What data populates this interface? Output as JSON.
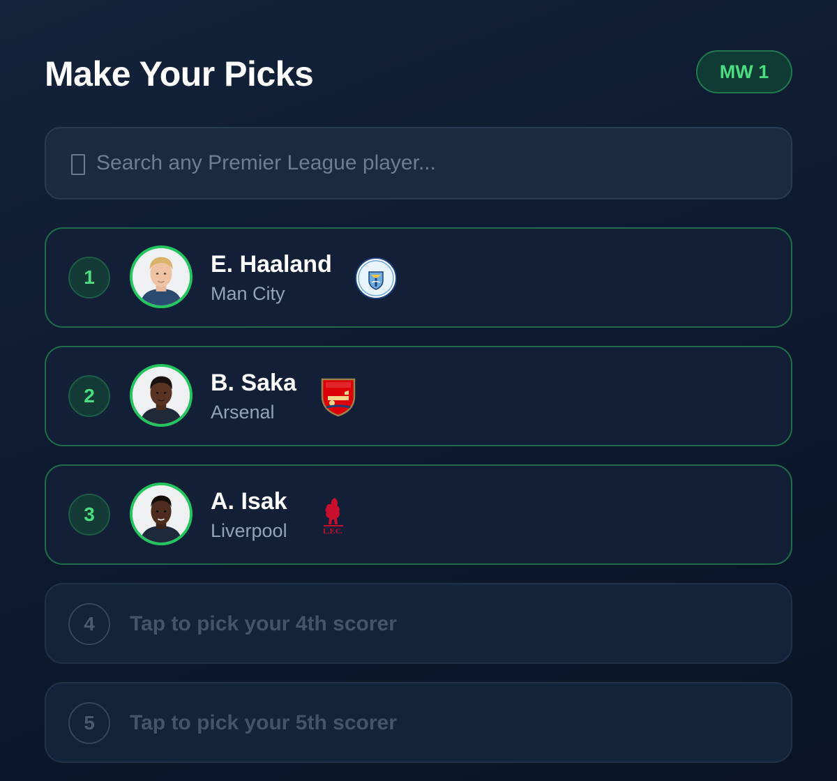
{
  "header": {
    "title": "Make Your Picks",
    "matchweek_badge": "MW 1"
  },
  "search": {
    "icon": "search-icon",
    "placeholder": "Search any Premier League player..."
  },
  "picks": [
    {
      "rank": "1",
      "name": "E. Haaland",
      "team": "Man City",
      "crest": "man-city-crest-icon",
      "photo": "haaland-photo"
    },
    {
      "rank": "2",
      "name": "B. Saka",
      "team": "Arsenal",
      "crest": "arsenal-crest-icon",
      "photo": "saka-photo"
    },
    {
      "rank": "3",
      "name": "A. Isak",
      "team": "Liverpool",
      "crest": "liverpool-crest-icon",
      "photo": "isak-photo"
    }
  ],
  "empty_slots": [
    {
      "rank": "4",
      "prompt": "Tap to pick your 4th scorer"
    },
    {
      "rank": "5",
      "prompt": "Tap to pick your 5th scorer"
    }
  ],
  "colors": {
    "accent": "#22c55e",
    "accent_text": "#4ade80",
    "background": "#0f1b31",
    "card": "#121f37",
    "muted_text": "#94a3b8"
  }
}
